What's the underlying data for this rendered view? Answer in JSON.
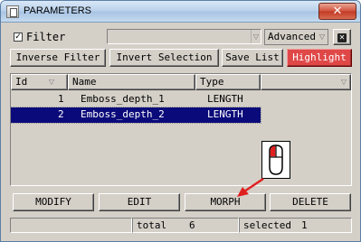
{
  "window": {
    "title": "PARAMETERS",
    "close_glyph": "✕"
  },
  "filter": {
    "checked": true,
    "check_glyph": "✓",
    "label": "Filter",
    "value": "",
    "mode": "Advanced",
    "clear_glyph": "✕"
  },
  "toolbar": {
    "inverse_filter": "Inverse Filter",
    "invert_selection": "Invert Selection",
    "save_list": "Save List",
    "highlight": "Highlight",
    "highlight_color": "#e04848"
  },
  "table": {
    "columns": [
      "Id",
      "Name",
      "Type"
    ],
    "rows": [
      {
        "id": "1",
        "name": "Emboss_depth_1",
        "type": "LENGTH",
        "selected": false
      },
      {
        "id": "2",
        "name": "Emboss_depth_2",
        "type": "LENGTH",
        "selected": true
      }
    ],
    "selection_color": "#0a0a7a"
  },
  "actions": {
    "modify": "MODIFY",
    "edit": "EDIT",
    "morph": "MORPH",
    "delete": "DELETE"
  },
  "status": {
    "total_label": "total",
    "total_value": "6",
    "selected_label": "selected",
    "selected_value": "1"
  },
  "annotation": {
    "icon": "mouse-click-icon",
    "arrow_color": "#e02020"
  }
}
